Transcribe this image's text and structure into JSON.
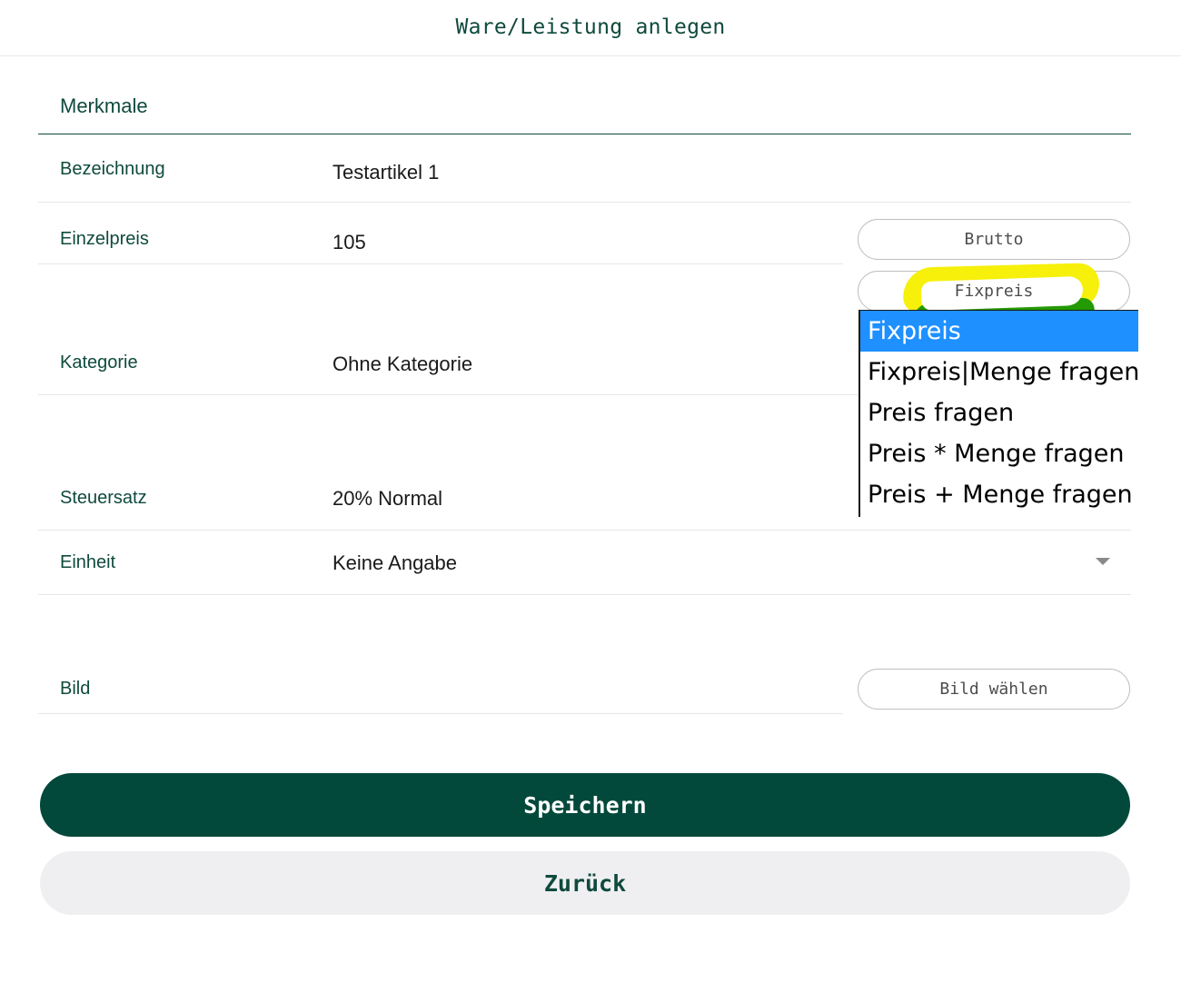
{
  "header": {
    "title": "Ware/Leistung anlegen"
  },
  "section": {
    "title": "Merkmale"
  },
  "fields": {
    "bezeichnung": {
      "label": "Bezeichnung",
      "value": "Testartikel 1"
    },
    "einzelpreis": {
      "label": "Einzelpreis",
      "value": "105"
    },
    "kategorie": {
      "label": "Kategorie",
      "value": "Ohne Kategorie"
    },
    "steuersatz": {
      "label": "Steuersatz",
      "value": "20% Normal"
    },
    "einheit": {
      "label": "Einheit",
      "value": "Keine Angabe"
    },
    "bild": {
      "label": "Bild"
    }
  },
  "price_mode": {
    "label": "Brutto"
  },
  "price_type": {
    "label": "Fixpreis",
    "options": [
      "Fixpreis",
      "Fixpreis|Menge fragen",
      "Preis fragen",
      "Preis * Menge fragen",
      "Preis + Menge fragen"
    ],
    "selected": "Fixpreis"
  },
  "image_button": {
    "label": "Bild wählen"
  },
  "actions": {
    "save": "Speichern",
    "back": "Zurück"
  },
  "colors": {
    "brand": "#02493b",
    "selection": "#1e90ff",
    "annotation_yellow": "#f6f00a",
    "annotation_green": "#239a06"
  },
  "icons": {
    "dropdown": "chevron-down-icon"
  }
}
